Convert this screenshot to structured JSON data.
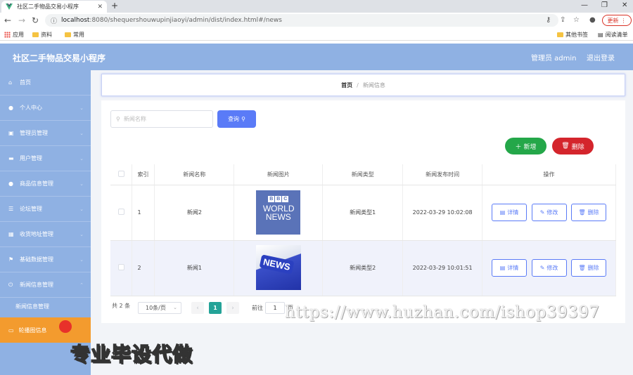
{
  "browser": {
    "tab_title": "社区二手物品交易小程序",
    "url_host": "localhost",
    "url_rest": ":8080/shequershouwupinjiaoyi/admin/dist/index.html#/news",
    "update_label": "更新",
    "bookmarks": [
      "应用",
      "资料",
      "常用"
    ],
    "bookmarks_right": [
      "其他书签",
      "阅读清单"
    ]
  },
  "header": {
    "title": "社区二手物品交易小程序",
    "admin_label": "管理员 admin",
    "logout_label": "退出登录"
  },
  "sidebar": {
    "items": [
      {
        "label": "首页",
        "icon": "home-icon"
      },
      {
        "label": "个人中心",
        "icon": "user-icon"
      },
      {
        "label": "管理员管理",
        "icon": "briefcase-icon"
      },
      {
        "label": "用户管理",
        "icon": "id-card-icon"
      },
      {
        "label": "商品信息管理",
        "icon": "user-icon"
      },
      {
        "label": "论坛管理",
        "icon": "list-icon"
      },
      {
        "label": "收货地址管理",
        "icon": "grid-icon"
      },
      {
        "label": "基础数据管理",
        "icon": "flag-icon"
      },
      {
        "label": "新闻信息管理",
        "icon": "power-icon"
      }
    ],
    "submenu_label": "新闻信息管理",
    "active_label": "轮播图信息"
  },
  "breadcrumb": {
    "home": "首页",
    "separator": "/",
    "current": "新闻信息"
  },
  "search": {
    "placeholder": "新闻名称",
    "button_label": "查询"
  },
  "actions": {
    "add_label": "新增",
    "delete_label": "删除"
  },
  "table": {
    "headers": [
      "索引",
      "新闻名称",
      "新闻图片",
      "新闻类型",
      "新闻发布时间",
      "操作"
    ],
    "rows": [
      {
        "index": "1",
        "name": "新闻2",
        "image": "bbc-world-news-image",
        "image_text": "WORLD NEWS",
        "image_logo": [
          "B",
          "B",
          "C"
        ],
        "type": "新闻类型1",
        "time": "2022-03-29 10:02:08"
      },
      {
        "index": "2",
        "name": "新闻1",
        "image": "news-key-image",
        "image_text": "NEWS",
        "type": "新闻类型2",
        "time": "2022-03-29 10:01:51"
      }
    ],
    "row_actions": {
      "detail": "详情",
      "edit": "修改",
      "delete": "删除"
    }
  },
  "pagination": {
    "total": "共 2 条",
    "page_size": "10条/页",
    "current_page": "1",
    "goto_label": "前往",
    "goto_value": "1",
    "page_suffix": "页"
  },
  "overlays": {
    "watermark": "https://www.huzhan.com/ishop39397",
    "promo": "专业毕设代做"
  },
  "colors": {
    "header_bg": "#8fb1e3",
    "active_menu": "#f39b2e",
    "primary": "#5a7bf7",
    "success": "#24a749",
    "danger": "#d4252c",
    "pager_active": "#24a398"
  }
}
